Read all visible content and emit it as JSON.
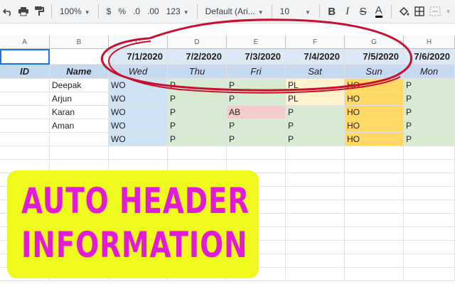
{
  "toolbar": {
    "zoom": "100%",
    "currency": "$",
    "percent": "%",
    "dec_dec": ".0",
    "dec_inc": ".00",
    "more_formats": "123",
    "font": "Default (Ari...",
    "font_size": "10",
    "bold": "B",
    "italic": "I",
    "strike": "S",
    "text_color": "A"
  },
  "columns": [
    "A",
    "B",
    "C",
    "D",
    "E",
    "F",
    "G",
    "H"
  ],
  "header_dates": [
    "7/1/2020",
    "7/2/2020",
    "7/3/2020",
    "7/4/2020",
    "7/5/2020",
    "7/6/2020"
  ],
  "header_labels": {
    "id": "ID",
    "name": "Name"
  },
  "header_days": [
    "Wed",
    "Thu",
    "Fri",
    "Sat",
    "Sun",
    "Mon"
  ],
  "rows": [
    {
      "name": "Deepak",
      "values": [
        "WO",
        "P",
        "P",
        "PL",
        "HO",
        "P"
      ]
    },
    {
      "name": "Arjun",
      "values": [
        "WO",
        "P",
        "P",
        "PL",
        "HO",
        "P"
      ]
    },
    {
      "name": "Karan",
      "values": [
        "WO",
        "P",
        "AB",
        "P",
        "HO",
        "P"
      ]
    },
    {
      "name": "Aman",
      "values": [
        "WO",
        "P",
        "P",
        "P",
        "HO",
        "P"
      ]
    },
    {
      "name": "",
      "values": [
        "WO",
        "P",
        "P",
        "P",
        "HO",
        "P"
      ]
    }
  ],
  "banner": {
    "line1": "AUTO HEADER",
    "line2": "INFORMATION"
  },
  "colors": {
    "wo": "#cfe2f3",
    "p": "#d9ead3",
    "pl": "#fff2cc",
    "ho": "#ffd966",
    "ab": "#f4cccc",
    "banner_bg": "#f0f91e",
    "banner_text": "#e21ad9",
    "circle": "#c8102e"
  }
}
